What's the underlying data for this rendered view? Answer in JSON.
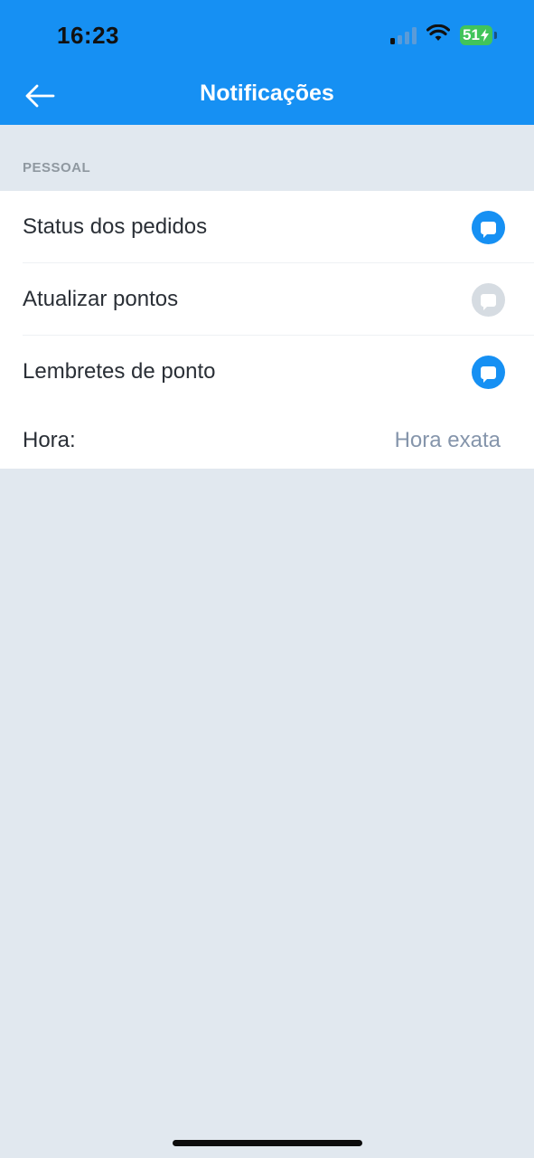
{
  "status_bar": {
    "time": "16:23",
    "battery_level": "51",
    "signal_bars_active": 1,
    "signal_bars_total": 4
  },
  "header": {
    "title": "Notificações",
    "back_icon": "arrow-left-icon"
  },
  "section": {
    "label": "PESSOAL"
  },
  "items": [
    {
      "label": "Status dos pedidos",
      "enabled": true
    },
    {
      "label": "Atualizar pontos",
      "enabled": false
    },
    {
      "label": "Lembretes de ponto",
      "enabled": true
    }
  ],
  "time_setting": {
    "label": "Hora:",
    "value": "Hora exata"
  },
  "colors": {
    "accent": "#1690f3",
    "toggle_off": "#d6dce2",
    "background": "#e1e8ef"
  }
}
